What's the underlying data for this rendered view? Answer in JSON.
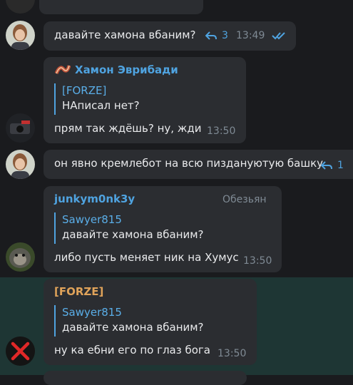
{
  "colors": {
    "background": "#1a1b1e",
    "bubble": "#2b2d31",
    "highlight_row": "#1e3634",
    "accent_blue": "#4fa3e0",
    "sender_orange": "#e0a35a",
    "checks": "#4fa3e0"
  },
  "messages": [
    {
      "text": "давайте хамона вбаним?",
      "replies": "3",
      "time": "13:49",
      "avatar_icon": "user-photo-avatar",
      "status_icon": "double-check-icon"
    },
    {
      "sender": "Хамон Эврибади",
      "sender_icon": "bacon-emoji-icon",
      "quote": {
        "name": "[FORZE]",
        "text": "НАписал нет?"
      },
      "text": "прям так ждёшь? ну, жди",
      "time": "13:50",
      "avatar_icon": "camera-photo-avatar"
    },
    {
      "text": "он явно кремлебот на всю пиздануютую башку",
      "replies": "1",
      "avatar_icon": "user-photo-avatar"
    },
    {
      "sender": "junkym0nk3y",
      "sender_tag": "Обезьян",
      "quote": {
        "name": "Sawyer815",
        "text": "давайте хамона вбаним?"
      },
      "text": "либо пусть меняет ник на Хумус",
      "time": "13:50",
      "avatar_icon": "monkey-photo-avatar"
    },
    {
      "sender": "[FORZE]",
      "quote": {
        "name": "Sawyer815",
        "text": "давайте хамона вбаним?"
      },
      "text": "ну ка ебни его по глаз бога",
      "time": "13:50",
      "avatar_icon": "red-x-avatar"
    }
  ]
}
